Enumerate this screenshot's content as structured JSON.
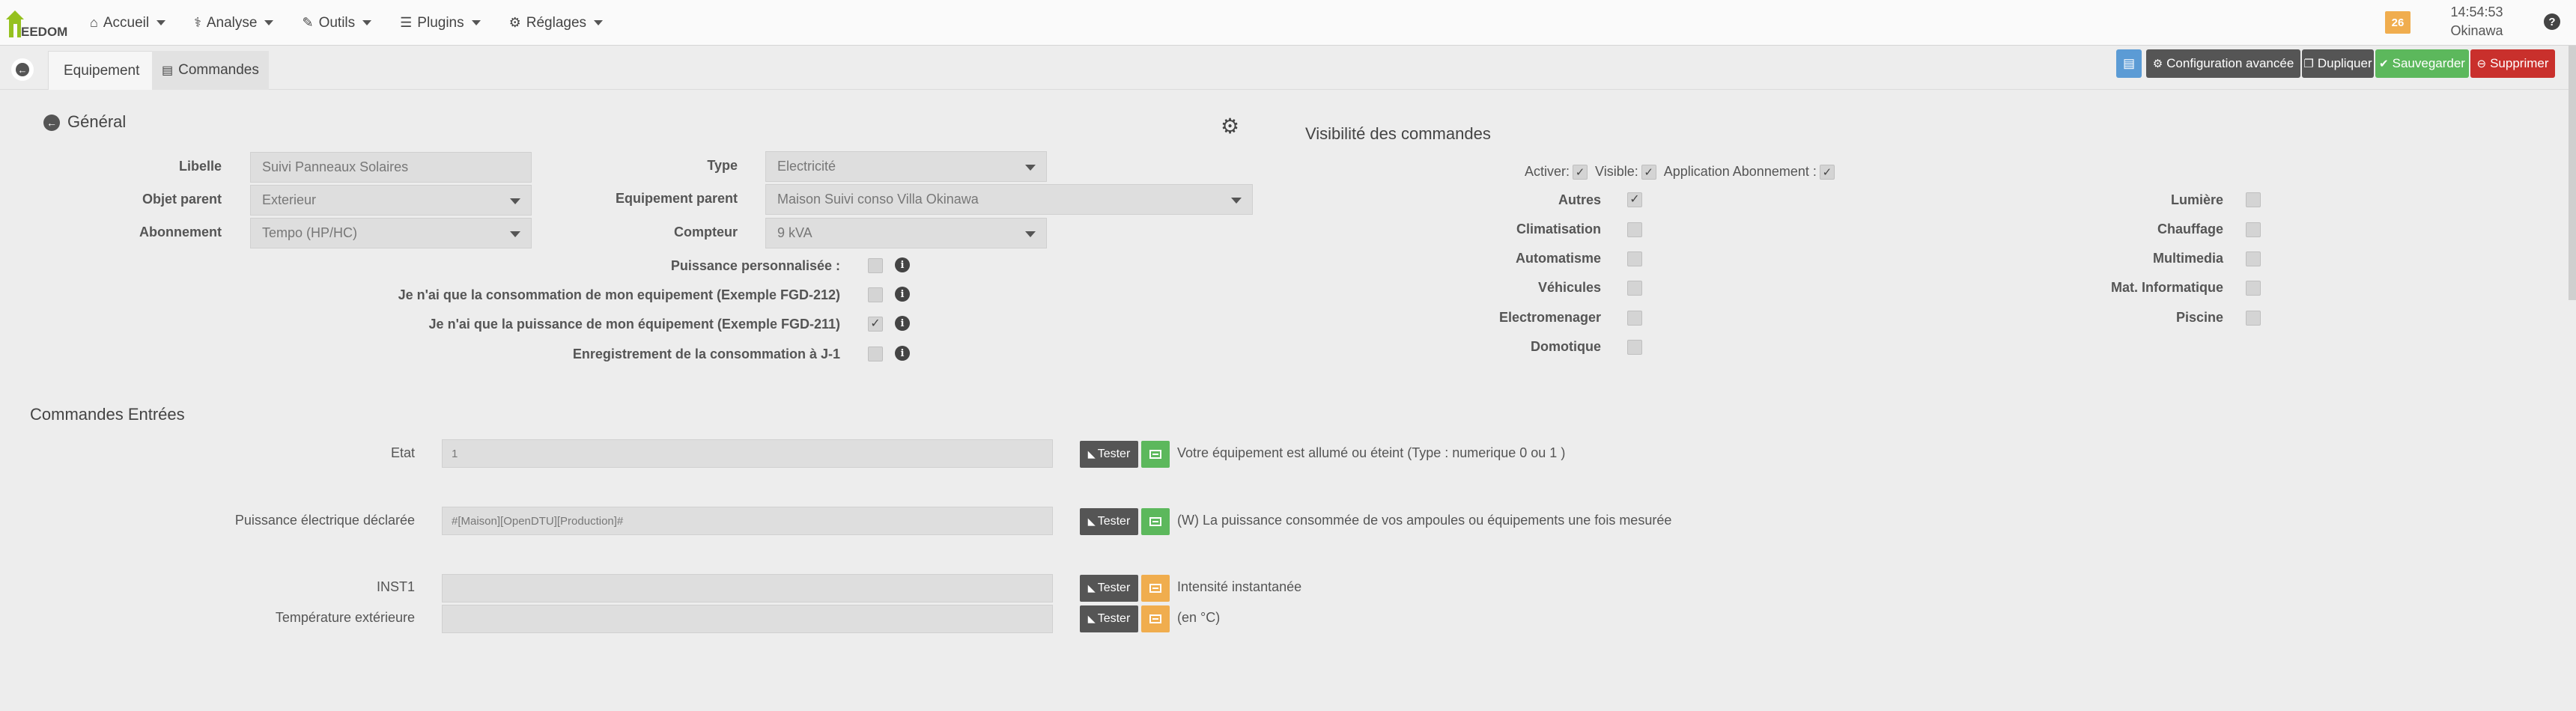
{
  "navbar": {
    "logo_text": "EEDOM",
    "menu": [
      {
        "icon": "home-icon",
        "glyph": "⌂",
        "label": "Accueil"
      },
      {
        "icon": "stethoscope-icon",
        "glyph": "⚕",
        "label": "Analyse"
      },
      {
        "icon": "wrench-icon",
        "glyph": "🔧",
        "label": "Outils"
      },
      {
        "icon": "list-icon",
        "glyph": "☰",
        "label": "Plugins"
      },
      {
        "icon": "cog-icon",
        "glyph": "⚙",
        "label": "Réglages"
      }
    ],
    "notifications_count": "26",
    "time": "14:54:53",
    "location": "Okinawa",
    "help": "?"
  },
  "tabs": {
    "equipement": "Equipement",
    "commandes": "Commandes"
  },
  "actions": {
    "advanced_config": "Configuration avancée",
    "duplicate": "Dupliquer",
    "save": "Sauvegarder",
    "delete": "Supprimer",
    "colors": {
      "doc": "#5b9bd5",
      "dark": "#555555",
      "save": "#5cb85c",
      "delete": "#c9302c"
    }
  },
  "general": {
    "title": "Général",
    "libelle_label": "Libelle",
    "libelle_value": "Suivi Panneaux Solaires",
    "objet_label": "Objet parent",
    "objet_value": "Exterieur",
    "abonnement_label": "Abonnement",
    "abonnement_value": "Tempo (HP/HC)",
    "type_label": "Type",
    "type_value": "Electricité",
    "equip_parent_label": "Equipement parent",
    "equip_parent_value": "Maison Suivi conso Villa Okinawa",
    "compteur_label": "Compteur",
    "compteur_value": "9 kVA",
    "options": [
      {
        "label": "Puissance personnalisée :",
        "checked": false
      },
      {
        "label": "Je n'ai que la consommation de mon equipement (Exemple FGD-212)",
        "checked": false
      },
      {
        "label": "Je n'ai que la puissance de mon équipement (Exemple FGD-211)",
        "checked": true
      },
      {
        "label": "Enregistrement de la consommation à J-1",
        "checked": false
      }
    ]
  },
  "visibility": {
    "title": "Visibilité des commandes",
    "activer": "Activer:",
    "visible": "Visible:",
    "abonnement": "Application Abonnement :",
    "left": [
      {
        "label": "Autres",
        "checked": true
      },
      {
        "label": "Climatisation",
        "checked": false
      },
      {
        "label": "Automatisme",
        "checked": false
      },
      {
        "label": "Véhicules",
        "checked": false
      },
      {
        "label": "Electromenager",
        "checked": false
      },
      {
        "label": "Domotique",
        "checked": false
      }
    ],
    "right": [
      {
        "label": "Lumière",
        "checked": false
      },
      {
        "label": "Chauffage",
        "checked": false
      },
      {
        "label": "Multimedia",
        "checked": false
      },
      {
        "label": "Mat. Informatique",
        "checked": false
      },
      {
        "label": "Piscine",
        "checked": false
      }
    ]
  },
  "commands": {
    "title": "Commandes Entrées",
    "test_label": "Tester",
    "rows": [
      {
        "label": "Etat",
        "value": "1",
        "icon_color": "#5cb85c",
        "desc": "Votre équipement est allumé ou éteint (Type : numerique 0 ou 1 )"
      },
      {
        "label": "Puissance électrique déclarée",
        "value": "#[Maison][OpenDTU][Production]#",
        "icon_color": "#5cb85c",
        "desc": "(W) La puissance consommée de vos ampoules ou équipements une fois mesurée"
      },
      {
        "label": "INST1",
        "value": "",
        "icon_color": "#f0ad4e",
        "desc": "Intensité instantanée"
      },
      {
        "label": "Température extérieure",
        "value": "",
        "icon_color": "#f0ad4e",
        "desc": "(en °C)"
      }
    ]
  }
}
